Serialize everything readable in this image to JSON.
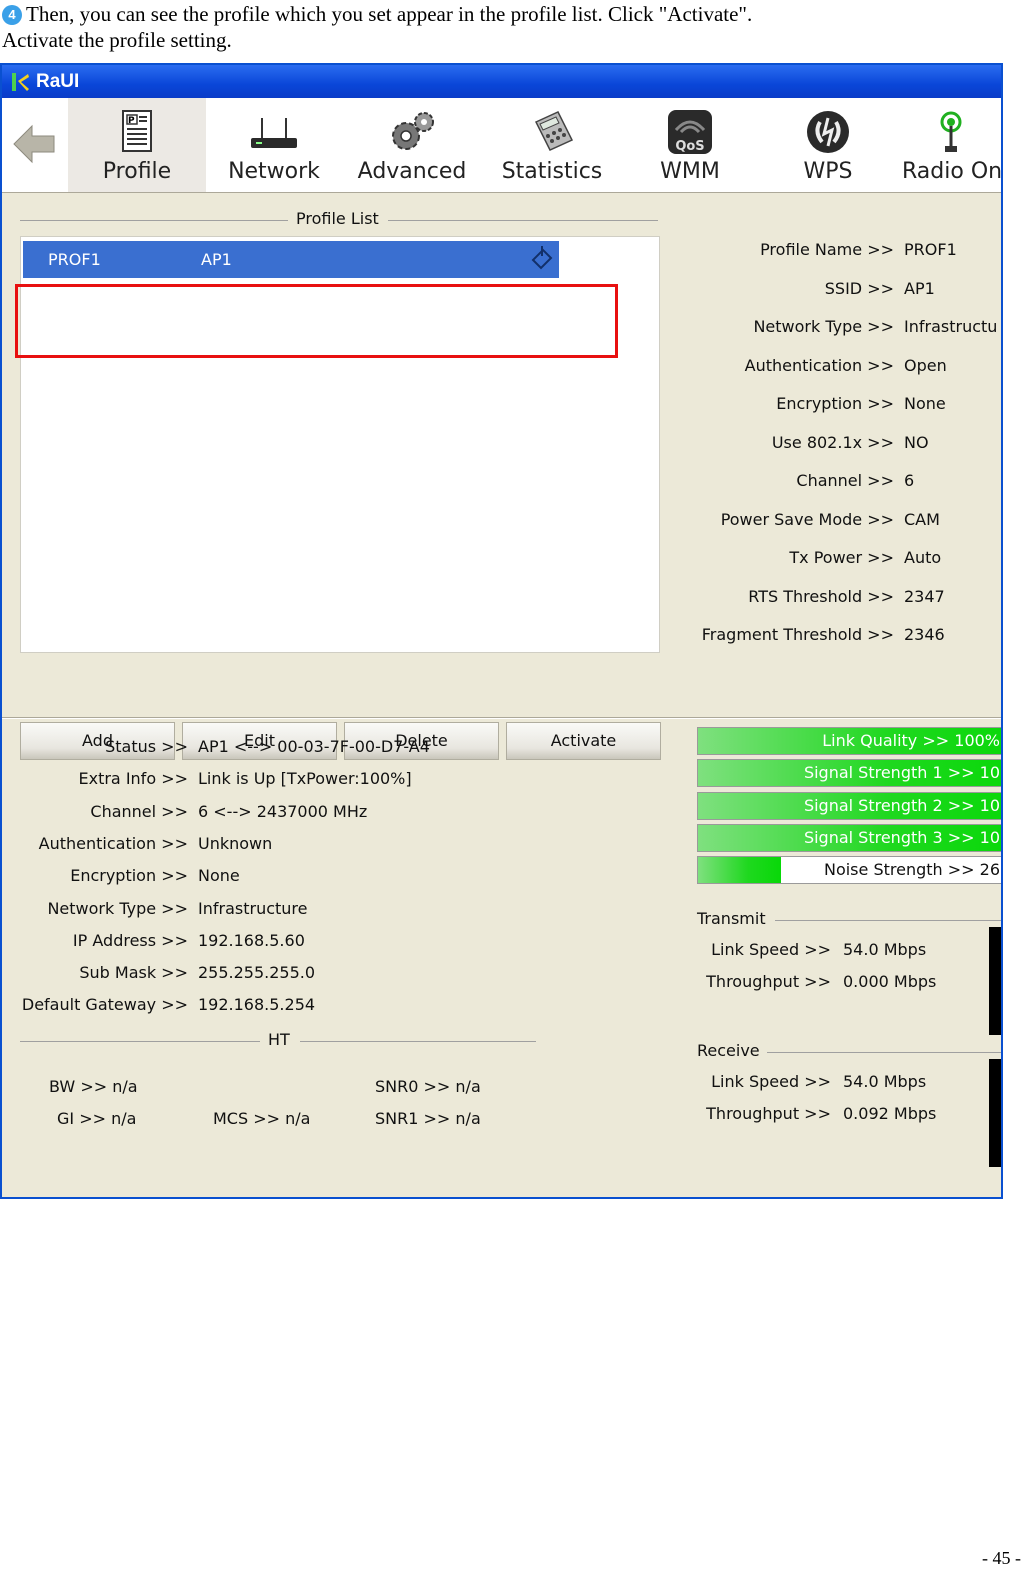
{
  "instruction": {
    "step_badge": "4",
    "line1": "Then, you can see the profile which you set appear in the profile list. Click \"Activate\".",
    "line2": "Activate the profile setting."
  },
  "window": {
    "title": "RaUI"
  },
  "toolbar": {
    "back_label": "",
    "items": [
      {
        "label": "Profile"
      },
      {
        "label": "Network"
      },
      {
        "label": "Advanced"
      },
      {
        "label": "Statistics"
      },
      {
        "label": "WMM"
      },
      {
        "label": "WPS"
      },
      {
        "label": "Radio On/"
      }
    ],
    "wmm_badge": "QoS"
  },
  "profile_list": {
    "title": "Profile List",
    "rows": [
      {
        "profile": "PROF1",
        "ssid": "AP1"
      }
    ],
    "buttons": {
      "add": "Add",
      "edit": "Edit",
      "delete": "Delete",
      "activate": "Activate"
    }
  },
  "profile_details": [
    {
      "label": "Profile Name >>",
      "value": "PROF1"
    },
    {
      "label": "SSID >>",
      "value": "AP1"
    },
    {
      "label": "Network Type >>",
      "value": "Infrastructu"
    },
    {
      "label": "Authentication >>",
      "value": "Open"
    },
    {
      "label": "Encryption >>",
      "value": "None"
    },
    {
      "label": "Use 802.1x >>",
      "value": "NO"
    },
    {
      "label": "Channel >>",
      "value": "6"
    },
    {
      "label": "Power Save Mode >>",
      "value": "CAM"
    },
    {
      "label": "Tx Power >>",
      "value": "Auto"
    },
    {
      "label": "RTS Threshold >>",
      "value": "2347"
    },
    {
      "label": "Fragment Threshold >>",
      "value": "2346"
    }
  ],
  "status": [
    {
      "label": "Status >>",
      "value": "AP1 <--> 00-03-7F-00-D7-A4"
    },
    {
      "label": "Extra Info >>",
      "value": "Link is Up [TxPower:100%]"
    },
    {
      "label": "Channel >>",
      "value": "6 <--> 2437000 MHz"
    },
    {
      "label": "Authentication >>",
      "value": "Unknown"
    },
    {
      "label": "Encryption >>",
      "value": "None"
    },
    {
      "label": "Network Type >>",
      "value": "Infrastructure"
    },
    {
      "label": "IP Address >>",
      "value": "192.168.5.60"
    },
    {
      "label": "Sub Mask >>",
      "value": "255.255.255.0"
    },
    {
      "label": "Default Gateway >>",
      "value": "192.168.5.254"
    }
  ],
  "ht": {
    "title": "HT",
    "bw": "BW >> n/a",
    "gi": "GI >> n/a",
    "mcs": "MCS >> n/a",
    "snr0": "SNR0 >> n/a",
    "snr1": "SNR1 >> n/a"
  },
  "signal_bars": [
    {
      "text": "Link Quality >> 100%",
      "level": 1.0
    },
    {
      "text": "Signal Strength 1 >> 10",
      "level": 1.0
    },
    {
      "text": "Signal Strength 2 >> 10",
      "level": 1.0
    },
    {
      "text": "Signal Strength 3 >> 10",
      "level": 1.0
    },
    {
      "text": "Noise Strength >> 26",
      "level": 0.26
    }
  ],
  "transmit": {
    "title": "Transmit",
    "link_speed_label": "Link Speed >>",
    "link_speed": "54.0 Mbps",
    "throughput_label": "Throughput >>",
    "throughput": "0.000 Mbps"
  },
  "receive": {
    "title": "Receive",
    "link_speed_label": "Link Speed >>",
    "link_speed": "54.0 Mbps",
    "throughput_label": "Throughput >>",
    "throughput": "0.092 Mbps"
  },
  "page_number": "- 45 -",
  "colors": {
    "highlight": "#3a6fd0",
    "callout": "#e81010",
    "bar_fill": "#1fd81f"
  }
}
